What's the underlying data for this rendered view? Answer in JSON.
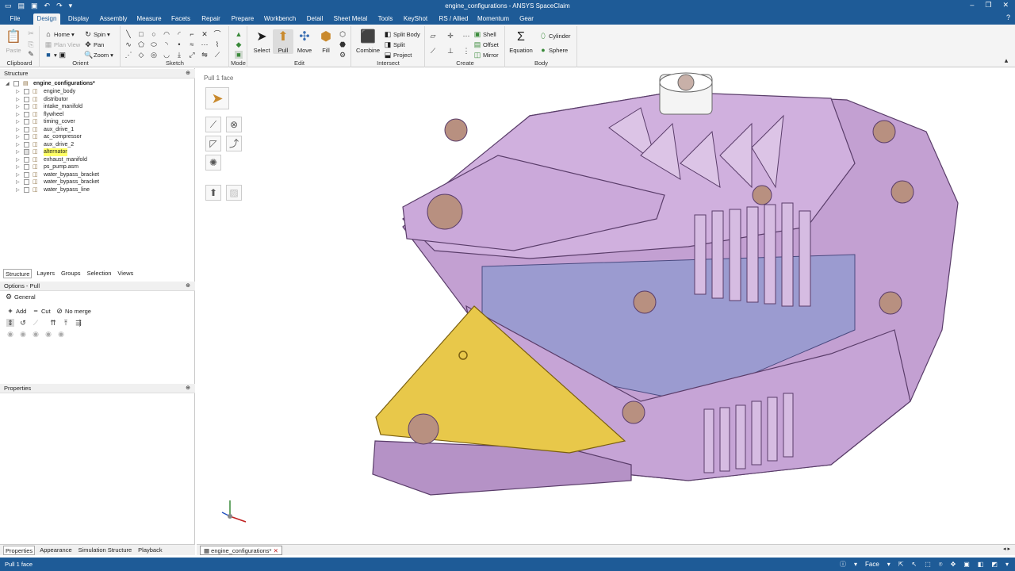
{
  "window": {
    "title": "engine_configurations - ANSYS SpaceClaim"
  },
  "menu_tabs": [
    "File",
    "Design",
    "Display",
    "Assembly",
    "Measure",
    "Facets",
    "Repair",
    "Prepare",
    "Workbench",
    "Detail",
    "Sheet Metal",
    "Tools",
    "KeyShot",
    "RS / Allied",
    "Momentum",
    "Gear"
  ],
  "active_tab": "Design",
  "ribbon": {
    "clipboard": {
      "label": "Clipboard",
      "paste": "Paste"
    },
    "orient": {
      "label": "Orient",
      "home": "Home",
      "spin": "Spin",
      "plan_view": "Plan View",
      "pan": "Pan",
      "zoom": "Zoom"
    },
    "sketch": {
      "label": "Sketch"
    },
    "mode": {
      "label": "Mode"
    },
    "edit": {
      "label": "Edit",
      "select": "Select",
      "pull": "Pull",
      "move": "Move",
      "fill": "Fill"
    },
    "intersect": {
      "label": "Intersect",
      "combine": "Combine",
      "split_body": "Split Body",
      "split": "Split",
      "project": "Project"
    },
    "create": {
      "label": "Create",
      "shell": "Shell",
      "offset": "Offset",
      "mirror": "Mirror"
    },
    "body": {
      "label": "Body",
      "equation": "Equation",
      "cylinder": "Cylinder",
      "sphere": "Sphere"
    }
  },
  "structure": {
    "header": "Structure",
    "root": "engine_configurations*",
    "items": [
      "engine_body",
      "distributor",
      "intake_manifold",
      "flywheel",
      "timing_cover",
      "aux_drive_1",
      "ac_compressor",
      "aux_drive_2",
      "alternator",
      "exhaust_manifold",
      "ps_pump.asm",
      "water_bypass_bracket",
      "water_bypass_bracket",
      "water_bypass_line"
    ],
    "highlighted": "alternator"
  },
  "struct_tabs": [
    "Structure",
    "Layers",
    "Groups",
    "Selection",
    "Views"
  ],
  "options": {
    "header": "Options - Pull",
    "section": "General",
    "add": "Add",
    "cut": "Cut",
    "no_merge": "No merge"
  },
  "properties": {
    "header": "Properties"
  },
  "bottom_tabs": [
    "Properties",
    "Appearance",
    "Simulation Structure",
    "Playback"
  ],
  "viewport": {
    "hint": "Pull 1 face"
  },
  "document_tab": "engine_configurations*",
  "status": {
    "text": "Pull 1 face",
    "selection_filter": "Face"
  },
  "colors": {
    "chrome": "#1e5b97",
    "part": "#c8a2d6",
    "selected_face": "#e8c84a"
  }
}
